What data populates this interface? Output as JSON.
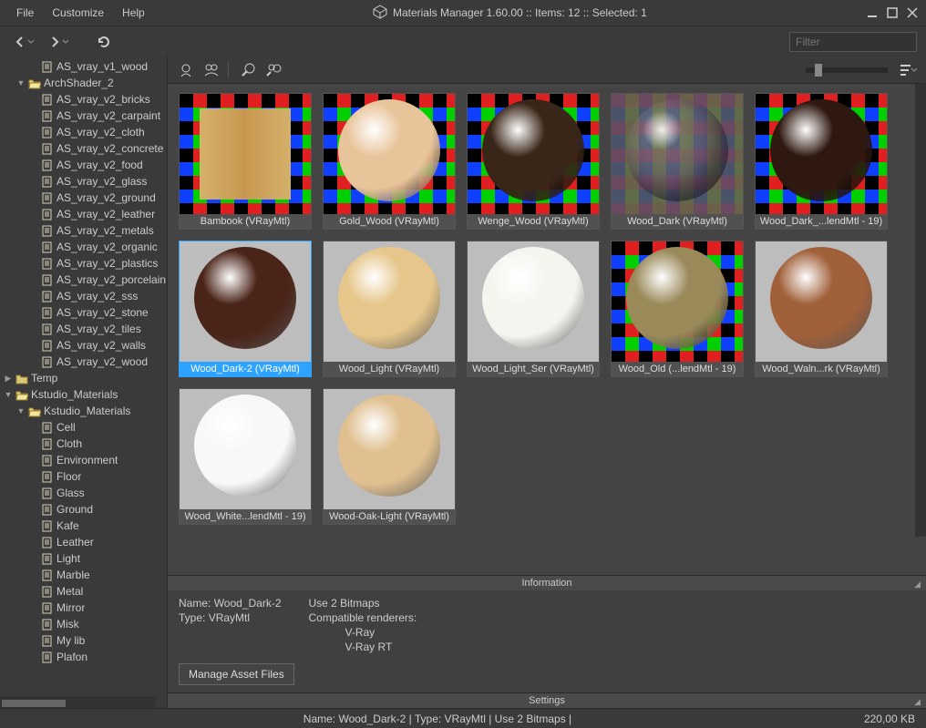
{
  "titlebar": {
    "menu": {
      "file": "File",
      "customize": "Customize",
      "help": "Help"
    },
    "title": "Materials Manager 1.60.00  ::  Items: 12  ::  Selected: 1"
  },
  "filter": {
    "placeholder": "Filter"
  },
  "tree": {
    "items": [
      {
        "label": "AS_vray_v1_wood",
        "indent": 2,
        "icon": "file",
        "arrow": ""
      },
      {
        "label": "ArchShader_2",
        "indent": 1,
        "icon": "folder-open",
        "arrow": "▼"
      },
      {
        "label": "AS_vray_v2_bricks",
        "indent": 2,
        "icon": "file",
        "arrow": ""
      },
      {
        "label": "AS_vray_v2_carpaint",
        "indent": 2,
        "icon": "file",
        "arrow": ""
      },
      {
        "label": "AS_vray_v2_cloth",
        "indent": 2,
        "icon": "file",
        "arrow": ""
      },
      {
        "label": "AS_vray_v2_concrete",
        "indent": 2,
        "icon": "file",
        "arrow": ""
      },
      {
        "label": "AS_vray_v2_food",
        "indent": 2,
        "icon": "file",
        "arrow": ""
      },
      {
        "label": "AS_vray_v2_glass",
        "indent": 2,
        "icon": "file",
        "arrow": ""
      },
      {
        "label": "AS_vray_v2_ground",
        "indent": 2,
        "icon": "file",
        "arrow": ""
      },
      {
        "label": "AS_vray_v2_leather",
        "indent": 2,
        "icon": "file",
        "arrow": ""
      },
      {
        "label": "AS_vray_v2_metals",
        "indent": 2,
        "icon": "file",
        "arrow": ""
      },
      {
        "label": "AS_vray_v2_organic",
        "indent": 2,
        "icon": "file",
        "arrow": ""
      },
      {
        "label": "AS_vray_v2_plastics",
        "indent": 2,
        "icon": "file",
        "arrow": ""
      },
      {
        "label": "AS_vray_v2_porcelain",
        "indent": 2,
        "icon": "file",
        "arrow": ""
      },
      {
        "label": "AS_vray_v2_sss",
        "indent": 2,
        "icon": "file",
        "arrow": ""
      },
      {
        "label": "AS_vray_v2_stone",
        "indent": 2,
        "icon": "file",
        "arrow": ""
      },
      {
        "label": "AS_vray_v2_tiles",
        "indent": 2,
        "icon": "file",
        "arrow": ""
      },
      {
        "label": "AS_vray_v2_walls",
        "indent": 2,
        "icon": "file",
        "arrow": ""
      },
      {
        "label": "AS_vray_v2_wood",
        "indent": 2,
        "icon": "file",
        "arrow": ""
      },
      {
        "label": "Temp",
        "indent": 0,
        "icon": "folder",
        "arrow": "▶"
      },
      {
        "label": "Kstudio_Materials",
        "indent": 0,
        "icon": "folder-open",
        "arrow": "▼"
      },
      {
        "label": "Kstudio_Materials",
        "indent": 1,
        "icon": "folder-open",
        "arrow": "▼"
      },
      {
        "label": "Cell",
        "indent": 2,
        "icon": "file",
        "arrow": ""
      },
      {
        "label": "Cloth",
        "indent": 2,
        "icon": "file",
        "arrow": ""
      },
      {
        "label": "Environment",
        "indent": 2,
        "icon": "file",
        "arrow": ""
      },
      {
        "label": "Floor",
        "indent": 2,
        "icon": "file",
        "arrow": ""
      },
      {
        "label": "Glass",
        "indent": 2,
        "icon": "file",
        "arrow": ""
      },
      {
        "label": "Ground",
        "indent": 2,
        "icon": "file",
        "arrow": ""
      },
      {
        "label": "Kafe",
        "indent": 2,
        "icon": "file",
        "arrow": ""
      },
      {
        "label": "Leather",
        "indent": 2,
        "icon": "file",
        "arrow": ""
      },
      {
        "label": "Light",
        "indent": 2,
        "icon": "file",
        "arrow": ""
      },
      {
        "label": "Marble",
        "indent": 2,
        "icon": "file",
        "arrow": ""
      },
      {
        "label": "Metal",
        "indent": 2,
        "icon": "file",
        "arrow": ""
      },
      {
        "label": "Mirror",
        "indent": 2,
        "icon": "file",
        "arrow": ""
      },
      {
        "label": "Misk",
        "indent": 2,
        "icon": "file",
        "arrow": ""
      },
      {
        "label": "My lib",
        "indent": 2,
        "icon": "file",
        "arrow": ""
      },
      {
        "label": "Plafon",
        "indent": 2,
        "icon": "file",
        "arrow": ""
      }
    ]
  },
  "gallery": {
    "items": [
      {
        "label": "Bambook (VRayMtl)",
        "bg": "checker",
        "sphere": "none",
        "tile": "#d4b06a"
      },
      {
        "label": "Gold_Wood (VRayMtl)",
        "bg": "checker",
        "sphere": "#e8c49a"
      },
      {
        "label": "Wenge_Wood (VRayMtl)",
        "bg": "checker",
        "sphere": "#3a2618"
      },
      {
        "label": "Wood_Dark (VRayMtl)",
        "bg": "checker-muted",
        "sphere": "glass"
      },
      {
        "label": "Wood_Dark_...lendMtl - 19)",
        "bg": "checker",
        "sphere": "#2e1810"
      },
      {
        "label": "Wood_Dark-2 (VRayMtl)",
        "bg": "flat-gray",
        "sphere": "#4a2418",
        "selected": true
      },
      {
        "label": "Wood_Light (VRayMtl)",
        "bg": "flat-gray",
        "sphere": "#e6c68a"
      },
      {
        "label": "Wood_Light_Ser (VRayMtl)",
        "bg": "flat-gray",
        "sphere": "#f5f5f0"
      },
      {
        "label": "Wood_Old (...lendMtl - 19)",
        "bg": "checker",
        "sphere": "#9a8a5a"
      },
      {
        "label": "Wood_Waln...rk (VRayMtl)",
        "bg": "flat-gray",
        "sphere": "#a0603a"
      },
      {
        "label": "Wood_White...lendMtl - 19)",
        "bg": "flat-gray",
        "sphere": "#f8f8f8"
      },
      {
        "label": "Wood-Oak-Light (VRayMtl)",
        "bg": "flat-gray",
        "sphere": "#e0c090"
      }
    ]
  },
  "info": {
    "header": "Information",
    "name_label": "Name: ",
    "name_value": "Wood_Dark-2",
    "type_label": "Type: ",
    "type_value": "VRayMtl",
    "bitmaps": "Use 2 Bitmaps",
    "compat": "Compatible renderers:",
    "r1": "V-Ray",
    "r2": "V-Ray RT",
    "manage": "Manage Asset Files"
  },
  "settings": {
    "header": "Settings"
  },
  "status": {
    "center": "Name: Wood_Dark-2 | Type: VRayMtl | Use 2 Bitmaps  |",
    "right": "220,00 KB"
  }
}
